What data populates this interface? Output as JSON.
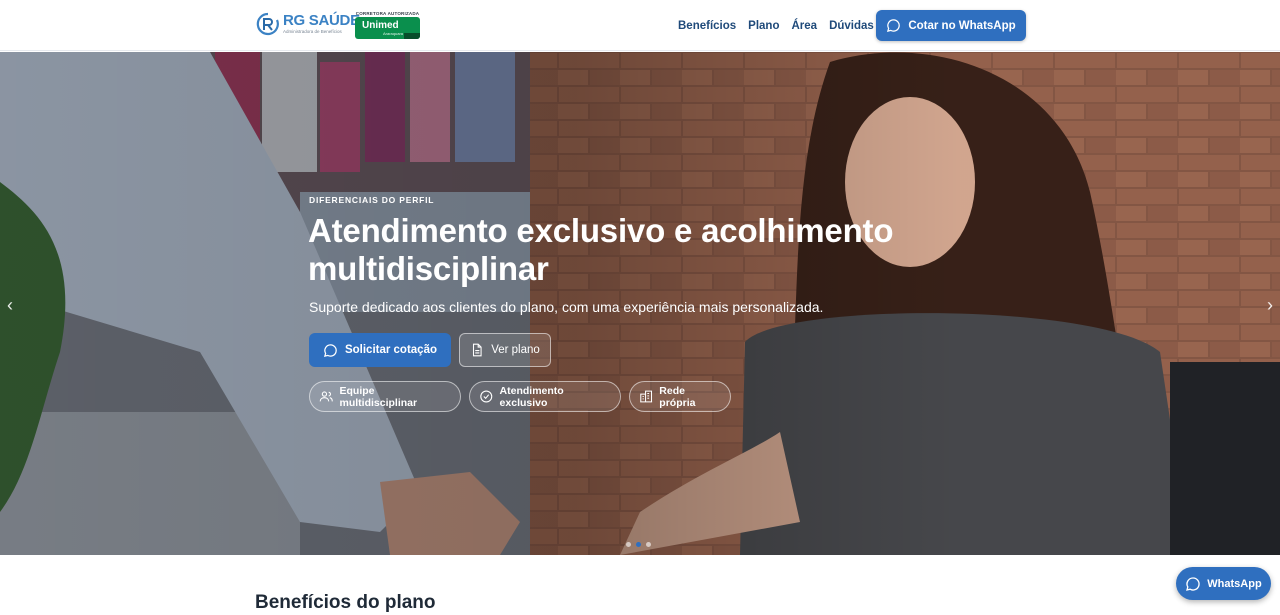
{
  "header": {
    "logo": {
      "name": "RG SAÚDE",
      "subtitle": "Administradora de Benefícios"
    },
    "partner": {
      "tag": "CORRETORA AUTORIZADA",
      "name": "Unimed",
      "location": "Araraquara"
    },
    "nav": [
      {
        "label": "Benefícios"
      },
      {
        "label": "Plano"
      },
      {
        "label": "Área"
      },
      {
        "label": "Dúvidas"
      }
    ],
    "cta_label": "Cotar no WhatsApp"
  },
  "hero": {
    "eyebrow": "DIFERENCIAIS DO PERFIL",
    "headline": "Atendimento exclusivo e acolhimento multidisciplinar",
    "subline": "Suporte dedicado aos clientes do plano, com uma experiência mais personalizada.",
    "primary_button": "Solicitar cotação",
    "secondary_button": "Ver plano",
    "chips": [
      {
        "label": "Equipe multidisciplinar",
        "icon": "users-icon"
      },
      {
        "label": "Atendimento exclusivo",
        "icon": "check-circle-icon"
      },
      {
        "label": "Rede própria",
        "icon": "building-icon"
      }
    ],
    "slides": {
      "count": 3,
      "active": 2
    },
    "arrows": {
      "prev": "‹",
      "next": "›"
    }
  },
  "section": {
    "title": "Benefícios do plano"
  },
  "floating_whatsapp": {
    "label": "WhatsApp"
  },
  "colors": {
    "brand_blue": "#2f6fbf",
    "unimed_green": "#0a8f4d",
    "nav_text": "#1f4a7a"
  }
}
